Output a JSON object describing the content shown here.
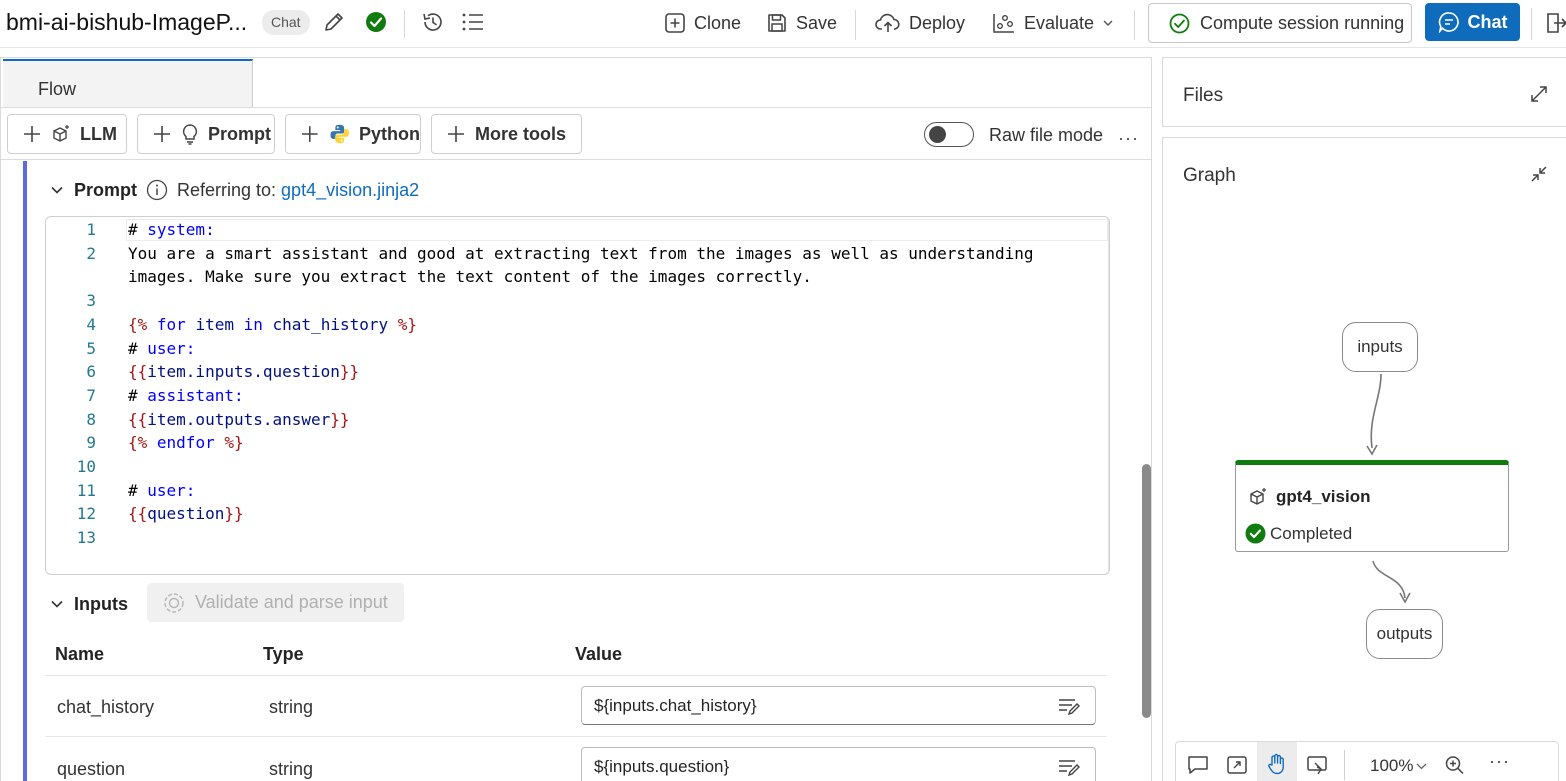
{
  "header": {
    "flow_title": "bmi-ai-bishub-ImageP...",
    "flow_type_badge": "Chat",
    "clone_label": "Clone",
    "save_label": "Save",
    "deploy_label": "Deploy",
    "evaluate_label": "Evaluate",
    "compute_status": "Compute session running",
    "chat_label": "Chat"
  },
  "tabs": [
    {
      "label": "Flow",
      "active": true
    }
  ],
  "toolbar": {
    "llm_label": "LLM",
    "prompt_label": "Prompt",
    "python_label": "Python",
    "more_tools_label": "More tools",
    "raw_file_mode_label": "Raw file mode",
    "raw_file_mode_enabled": false
  },
  "prompt_section": {
    "title": "Prompt",
    "referring_label": "Referring to:",
    "file_link": "gpt4_vision.jinja2",
    "code_lines": [
      {
        "n": "1",
        "text": "# system:"
      },
      {
        "n": "2",
        "text": "You are a smart assistant and good at extracting text from the images as well as understanding"
      },
      {
        "n": "",
        "text": "images. Make sure you extract the text content of the images correctly."
      },
      {
        "n": "3",
        "text": ""
      },
      {
        "n": "4",
        "text": "{% for item in chat_history %}"
      },
      {
        "n": "5",
        "text": "# user:"
      },
      {
        "n": "6",
        "text": "{{item.inputs.question}}"
      },
      {
        "n": "7",
        "text": "# assistant:"
      },
      {
        "n": "8",
        "text": "{{item.outputs.answer}}"
      },
      {
        "n": "9",
        "text": "{% endfor %}"
      },
      {
        "n": "10",
        "text": ""
      },
      {
        "n": "11",
        "text": "# user:"
      },
      {
        "n": "12",
        "text": "{{question}}"
      },
      {
        "n": "13",
        "text": ""
      }
    ]
  },
  "inputs_section": {
    "title": "Inputs",
    "validate_label": "Validate and parse input",
    "columns": [
      "Name",
      "Type",
      "Value"
    ],
    "rows": [
      {
        "name": "chat_history",
        "type": "string",
        "value": "${inputs.chat_history}"
      },
      {
        "name": "question",
        "type": "string",
        "value": "${inputs.question}"
      }
    ]
  },
  "files_panel": {
    "title": "Files"
  },
  "graph_panel": {
    "title": "Graph",
    "nodes": {
      "inputs": "inputs",
      "llm_node": "gpt4_vision",
      "llm_status": "Completed",
      "outputs": "outputs"
    },
    "zoom": "100%"
  },
  "colors": {
    "accent": "#0f6cbd",
    "success": "#107c10",
    "node_accent": "#5b6cdf"
  }
}
